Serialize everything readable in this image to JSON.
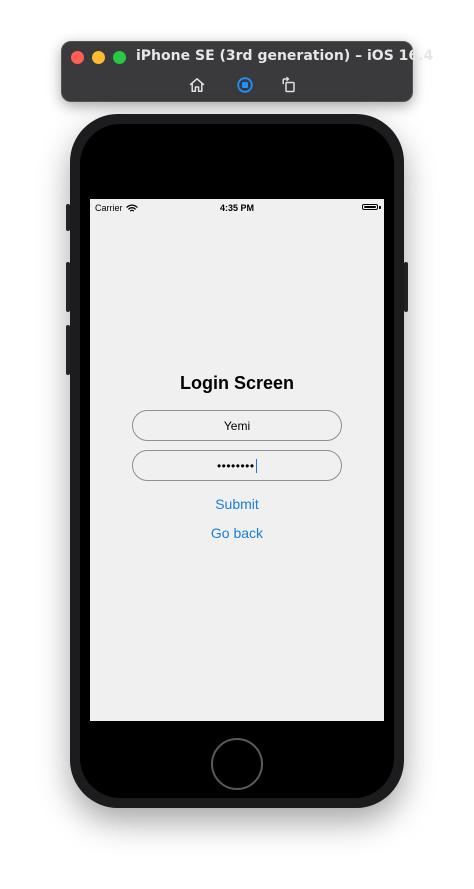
{
  "simulator": {
    "title": "iPhone SE (3rd generation) – iOS 16.4",
    "buttons": [
      {
        "name": "home",
        "icon": "home-icon"
      },
      {
        "name": "screenshot",
        "icon": "screenshot-icon"
      },
      {
        "name": "rotate",
        "icon": "rotate-icon"
      }
    ],
    "accent": "#1e90ff"
  },
  "status_bar": {
    "carrier": "Carrier",
    "time": "4:35 PM",
    "wifi_icon": "wifi-icon",
    "battery_icon": "battery-icon"
  },
  "login": {
    "title": "Login Screen",
    "username_value": "Yemi",
    "password_value": "••••••••",
    "submit_label": "Submit",
    "goback_label": "Go back",
    "link_color": "#1a7fd4"
  }
}
